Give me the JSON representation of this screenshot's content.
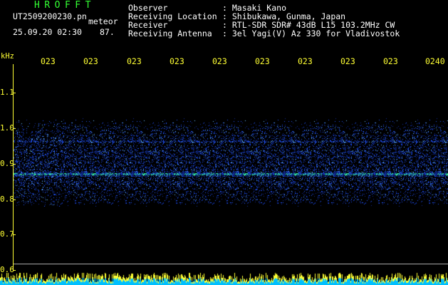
{
  "app_title": "HROFFT",
  "file_name": "UT2509200230.pn",
  "mode_label": "meteor",
  "date_time": "25.09.20 02:30",
  "counter_value": "87.",
  "station": [
    {
      "label": "Observer",
      "value": ": Masaki Kano"
    },
    {
      "label": "Receiving Location",
      "value": ": Shibukawa, Gunma, Japan"
    },
    {
      "label": "Receiver",
      "value": ": RTL-SDR SDR# 43dB L15 103.2MHz CW"
    },
    {
      "label": "Receiving Antenna",
      "value": ": 3el Yagi(V) Az 330 for Vladivostok"
    }
  ],
  "frequency_axis": {
    "unit": "kHz",
    "ticks": [
      "1.1",
      "1.0",
      "0.9",
      "0.8",
      "0.7",
      "0.6"
    ]
  },
  "time_ticks": [
    "023",
    "023",
    "023",
    "023",
    "023",
    "023",
    "023",
    "023",
    "023",
    "0240"
  ],
  "colors": {
    "title": "#33ff33",
    "axis": "#ffff33",
    "text": "#ffffff",
    "signal": "#1a55ff",
    "level_bars": "#00bfff"
  }
}
